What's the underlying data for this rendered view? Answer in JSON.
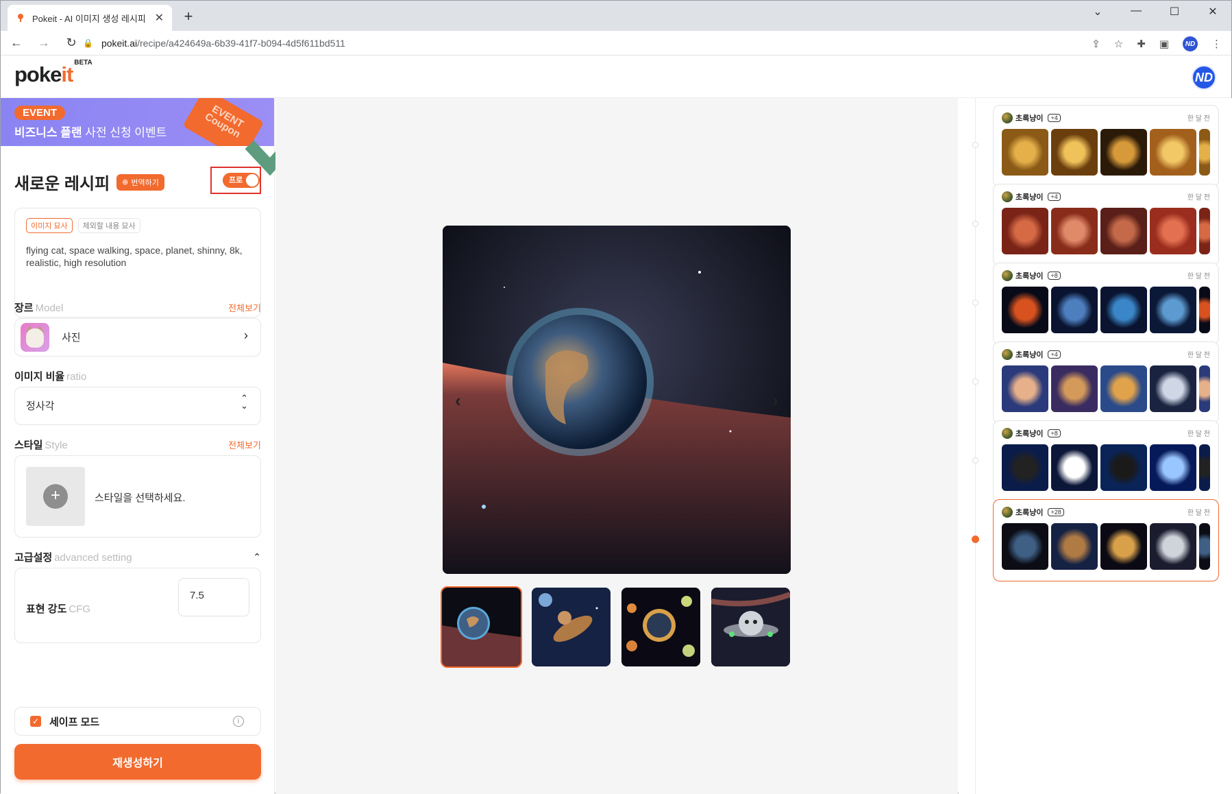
{
  "browser": {
    "tab_title": "Pokeit - AI 이미지 생성 레시피",
    "new_tab": "+",
    "url_host": "pokeit.ai",
    "url_path": "/recipe/a424649a-6b39-41f7-b094-4d5f611bd511",
    "profile_initials": "ND",
    "controls": [
      "⌄",
      "—",
      "☐",
      "✕"
    ]
  },
  "header": {
    "logo_main": "poke",
    "logo_accent": "it",
    "logo_badge": "BETA",
    "avatar": "ND"
  },
  "banner": {
    "event_label": "EVENT",
    "text_bold": "비즈니스 플랜",
    "text_rest": " 사전 신청 이벤트",
    "coupon": "EVENT\nCoupon"
  },
  "recipe": {
    "title": "새로운 레시피",
    "translate_button": "번역하기",
    "pro_toggle": "프로",
    "prompt_tab_active": "이미지 묘사",
    "prompt_tab_inactive": "제외할 내용 묘사",
    "prompt_text": "flying cat, space walking, space, planet, shinny, 8k, realistic, high resolution"
  },
  "model": {
    "label": "장르",
    "label_en": "Model",
    "view_all": "전체보기",
    "value": "사진"
  },
  "ratio": {
    "label": "이미지 비율",
    "label_en": "ratio",
    "value": "정사각"
  },
  "style": {
    "label": "스타일",
    "label_en": "Style",
    "view_all": "전체보기",
    "hint": "스타일을 선택하세요."
  },
  "advanced": {
    "label": "고급설정",
    "label_en": "advanced setting",
    "cfg_label": "표현 강도",
    "cfg_label_en": "CFG",
    "cfg_value": "7.5"
  },
  "safe_mode": {
    "label": "세이프 모드",
    "checked": true
  },
  "regenerate_button": "재생성하기",
  "history": [
    {
      "user": "초록냥이",
      "count": "+4",
      "time": "한 달 전",
      "theme": "gold",
      "active": false
    },
    {
      "user": "초록냥이",
      "count": "+4",
      "time": "한 달 전",
      "theme": "mars",
      "active": false
    },
    {
      "user": "초록냥이",
      "count": "+8",
      "time": "한 달 전",
      "theme": "earth",
      "active": false
    },
    {
      "user": "초록냥이",
      "count": "+4",
      "time": "한 달 전",
      "theme": "robot",
      "active": false
    },
    {
      "user": "초록냥이",
      "count": "+8",
      "time": "한 달 전",
      "theme": "blackcat",
      "active": false
    },
    {
      "user": "초록냥이",
      "count": "+28",
      "time": "한 달 전",
      "theme": "mixed",
      "active": true
    }
  ],
  "colors": {
    "accent": "#f26a2e",
    "banner": "#8a84f2",
    "highlight_box": "#e0302b",
    "check_mark": "#5d9c7f"
  }
}
